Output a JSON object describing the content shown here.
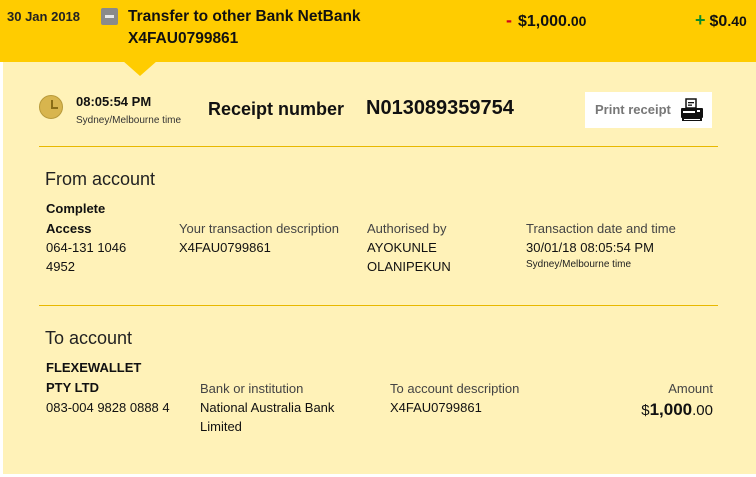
{
  "header": {
    "date": "30 Jan 2018",
    "title_line1": "Transfer to other Bank NetBank",
    "title_line2": "X4FAU0799861",
    "debit_sign": "-",
    "debit_amount": "$1,000",
    "debit_cents": ".00",
    "credit_sign": "+",
    "credit_amount": "$0",
    "credit_cents": ".40"
  },
  "receipt": {
    "time": "08:05:54 PM",
    "timezone": "Sydney/Melbourne time",
    "receipt_label": "Receipt number",
    "receipt_number": "N013089359754",
    "print_label": "Print receipt"
  },
  "from_account": {
    "title": "From account",
    "name_line1": "Complete",
    "name_line2": "Access",
    "number_line1": "064-131 1046",
    "number_line2": "4952",
    "desc_label": "Your transaction description",
    "desc_value": "X4FAU0799861",
    "auth_label": "Authorised by",
    "auth_line1": "AYOKUNLE",
    "auth_line2": "OLANIPEKUN",
    "datetime_label": "Transaction date and time",
    "datetime_value": "30/01/18 08:05:54 PM",
    "datetime_tz": "Sydney/Melbourne time"
  },
  "to_account": {
    "title": "To account",
    "name_line1": "FLEXEWALLET",
    "name_line2": "PTY LTD",
    "number": "083-004 9828 0888 4",
    "bank_label": "Bank or institution",
    "bank_line1": "National Australia Bank",
    "bank_line2": "Limited",
    "desc_label": "To account description",
    "desc_value": "X4FAU0799861",
    "amount_label": "Amount",
    "amount_currency": "$",
    "amount_whole": "1,000",
    "amount_cents": ".00"
  },
  "colors": {
    "header_bg": "#ffcc00",
    "panel_bg": "#fff2b8",
    "debit_sign": "#d0021b",
    "credit_sign": "#0c8c2a"
  },
  "icons": {
    "collapse": "minus-square-icon",
    "clock": "clock-icon",
    "printer": "printer-icon"
  }
}
